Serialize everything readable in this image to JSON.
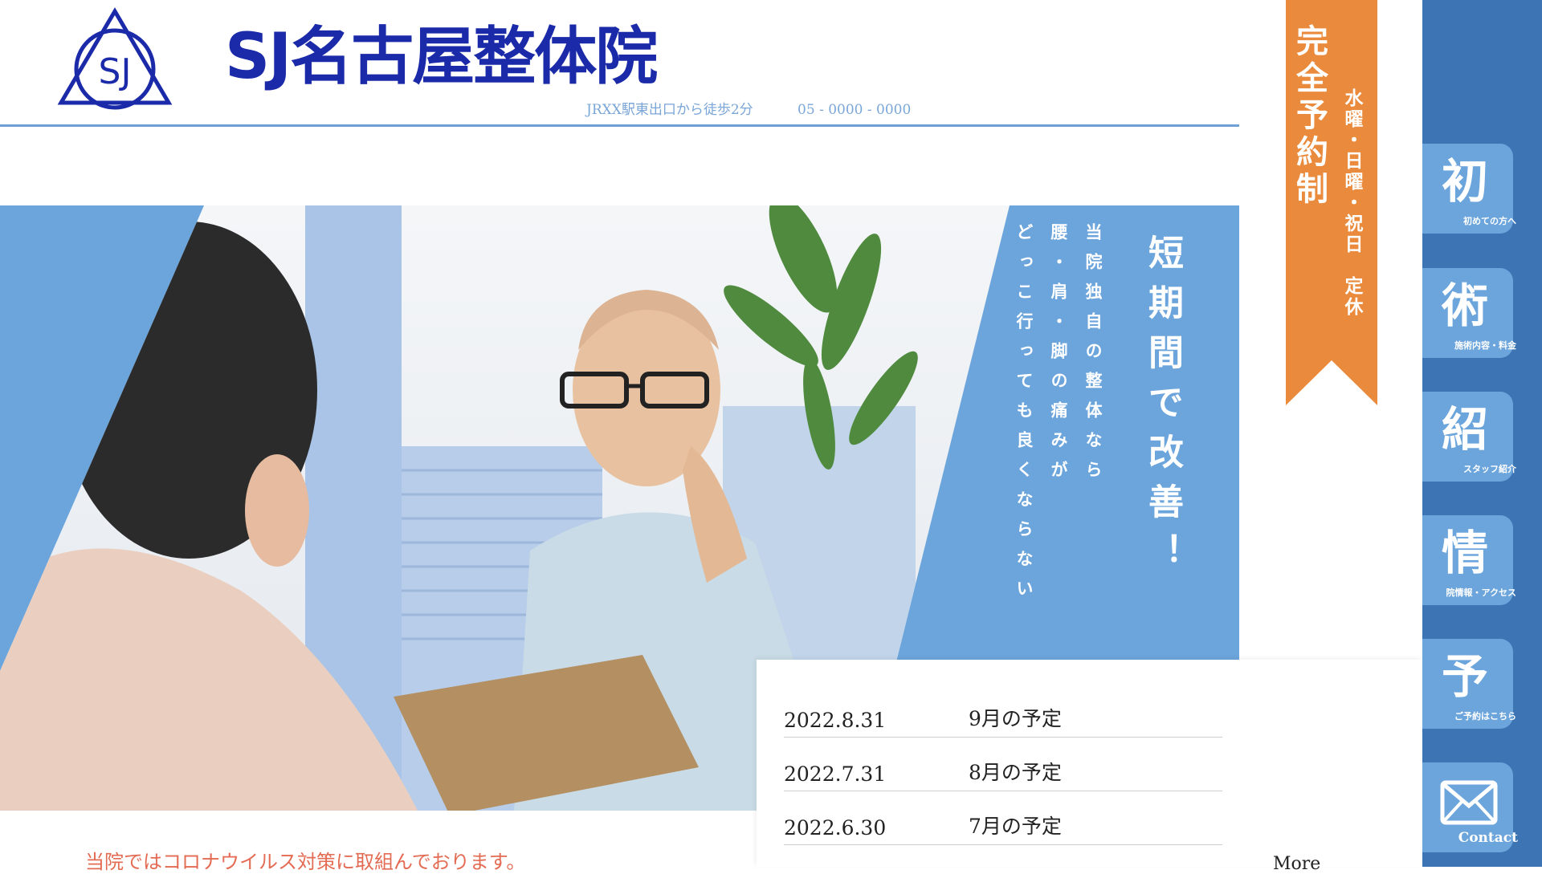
{
  "colors": {
    "brand_blue": "#1a2aa8",
    "accent_blue": "#6ca5dc",
    "sidebar_blue": "#3d75b4",
    "banner_orange": "#ea8a3c",
    "notice_red": "#e46b53"
  },
  "header": {
    "logo_text": "SJ",
    "title": "SJ名古屋整体院",
    "access": "JRXX駅東出口から徒歩2分",
    "tel": "05 - 0000 - 0000"
  },
  "banner": {
    "main": "完全予約制",
    "sub": "水曜・日曜・祝日　定休"
  },
  "hero": {
    "headline": "短期間で改善！",
    "lines": [
      "当院独自の整体なら",
      "腰・肩・脚の痛みが",
      "どっこ行っても良くならない"
    ]
  },
  "nav": [
    {
      "kanji": "初",
      "label": "初めての方へ"
    },
    {
      "kanji": "術",
      "label": "施術内容・料金"
    },
    {
      "kanji": "紹",
      "label": "スタッフ紹介"
    },
    {
      "kanji": "情",
      "label": "院情報・アクセス"
    },
    {
      "kanji": "予",
      "label": "ご予約はこちら"
    }
  ],
  "contact": {
    "label": "Contact",
    "icon": "mail-icon"
  },
  "news": {
    "items": [
      {
        "date": "2022.8.31",
        "title": "9月の予定"
      },
      {
        "date": "2022.7.31",
        "title": "8月の予定"
      },
      {
        "date": "2022.6.30",
        "title": "7月の予定"
      }
    ],
    "more": "More"
  },
  "notice": "当院ではコロナウイルス対策に取組んでおります。"
}
